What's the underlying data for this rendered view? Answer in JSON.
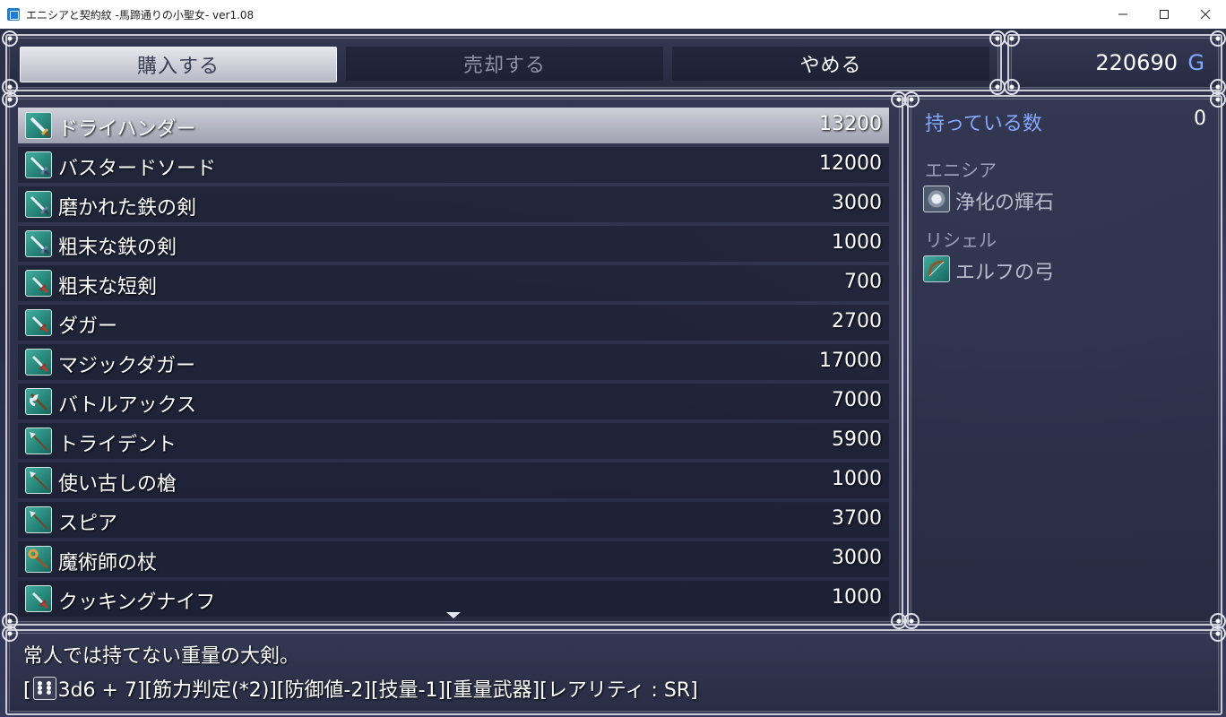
{
  "window": {
    "title": "エニシアと契約紋 -馬蹄通りの小聖女- ver1.08",
    "buttons": [
      "minimize-icon",
      "maximize-icon",
      "close-icon"
    ]
  },
  "commands": {
    "buy": "購入する",
    "sell": "売却する",
    "cancel": "やめる"
  },
  "gold": {
    "value": "220690",
    "unit": "G"
  },
  "items": [
    {
      "name": "ドライハンダー",
      "price": "13200",
      "icon": "greatsword-icon"
    },
    {
      "name": "バスタードソード",
      "price": "12000",
      "icon": "sword-icon"
    },
    {
      "name": "磨かれた鉄の剣",
      "price": "3000",
      "icon": "sword-icon"
    },
    {
      "name": "粗末な鉄の剣",
      "price": "1000",
      "icon": "sword-icon"
    },
    {
      "name": "粗末な短剣",
      "price": "700",
      "icon": "dagger-icon"
    },
    {
      "name": "ダガー",
      "price": "2700",
      "icon": "dagger-icon"
    },
    {
      "name": "マジックダガー",
      "price": "17000",
      "icon": "dagger-icon"
    },
    {
      "name": "バトルアックス",
      "price": "7000",
      "icon": "axe-icon"
    },
    {
      "name": "トライデント",
      "price": "5900",
      "icon": "spear-icon"
    },
    {
      "name": "使い古しの槍",
      "price": "1000",
      "icon": "spear-icon"
    },
    {
      "name": "スピア",
      "price": "3700",
      "icon": "spear-icon"
    },
    {
      "name": "魔術師の杖",
      "price": "3000",
      "icon": "staff-icon"
    },
    {
      "name": "クッキングナイフ",
      "price": "1000",
      "icon": "dagger-icon"
    }
  ],
  "status": {
    "owned_label": "持っている数",
    "owned_value": "0",
    "characters": [
      {
        "name": "エニシア",
        "equipment": "浄化の輝石",
        "icon": "gem-icon"
      },
      {
        "name": "リシェル",
        "equipment": "エルフの弓",
        "icon": "bow-icon"
      }
    ]
  },
  "help": {
    "line1": "常人では持てない重量の大剣。",
    "line2_prefix": "[",
    "line2_text": "3d6 + 7][筋力判定(*2)][防御値-2][技量-1][重量武器][レアリティ : SR]"
  },
  "colors": {
    "system_blue": "#84a8ff",
    "icon_teal": "#2a8a7e"
  }
}
